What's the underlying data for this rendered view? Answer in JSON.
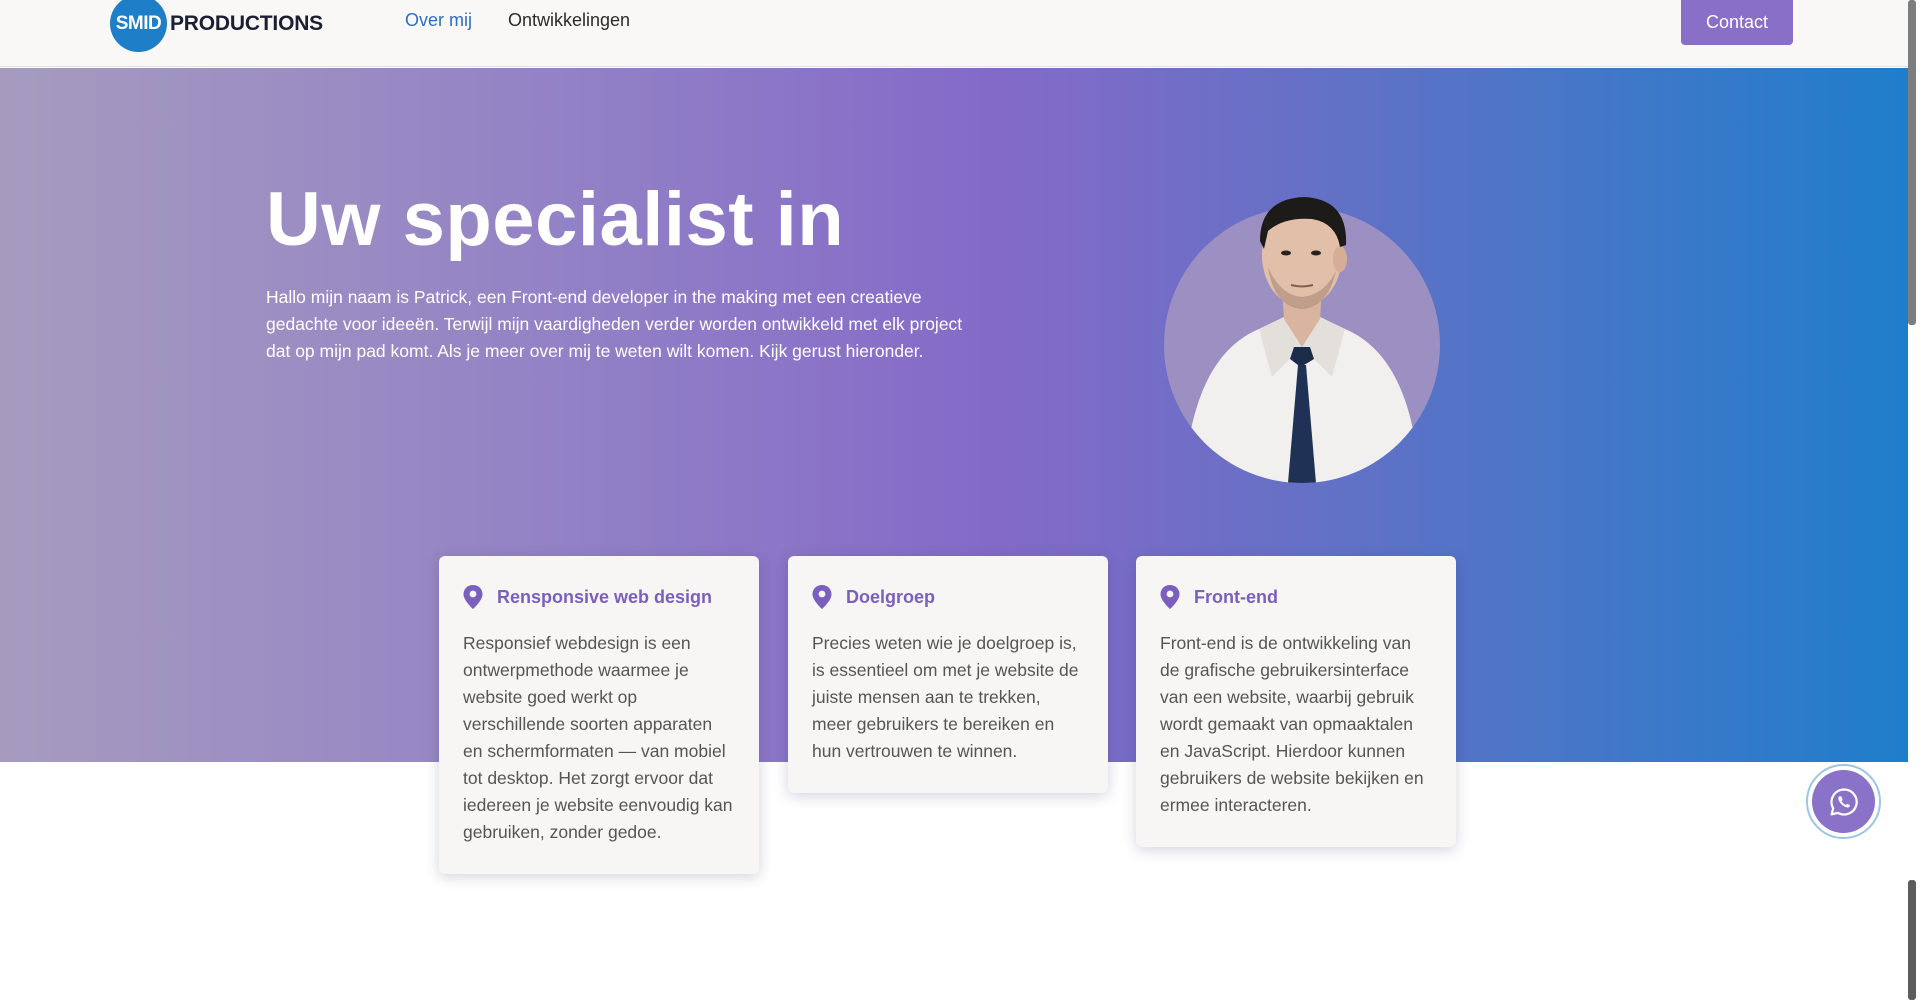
{
  "header": {
    "logo_mark": "SMID",
    "logo_text": "PRODUCTIONS",
    "nav": [
      {
        "label": "Over mij",
        "active": true
      },
      {
        "label": "Ontwikkelingen",
        "active": false
      }
    ],
    "contact_label": "Contact"
  },
  "hero": {
    "title": "Uw specialist in",
    "text": "Hallo mijn naam is Patrick, een Front-end developer in the making met een creatieve gedachte voor ideeën. Terwijl mijn vaardigheden verder worden ontwikkeld met elk project dat op mijn pad komt. Als je meer over mij te weten wilt komen. Kijk gerust hieronder."
  },
  "cards": [
    {
      "icon": "map-pin-icon",
      "title": "Rensponsive web design",
      "body": "Responsief webdesign is een ontwerpmethode waarmee je website goed werkt op verschillende soorten apparaten en schermformaten — van mobiel tot desktop. Het zorgt ervoor dat iedereen je website eenvoudig kan gebruiken, zonder gedoe."
    },
    {
      "icon": "map-pin-icon",
      "title": "Doelgroep",
      "body": "Precies weten wie je doelgroep is, is essentieel om met je website de juiste mensen aan te trekken, meer gebruikers te bereiken en hun vertrouwen te winnen."
    },
    {
      "icon": "map-pin-icon",
      "title": "Front-end",
      "body": "Front-end is de ontwikkeling van de grafische gebruikersinterface van een website, waarbij gebruik wordt gemaakt van opmaaktalen en JavaScript. Hierdoor kunnen gebruikers de website bekijken en ermee interacteren."
    }
  ],
  "floating": {
    "icon": "whatsapp-icon"
  },
  "colors": {
    "accent": "#8a6fc8",
    "brand_blue": "#1e7fc8",
    "card_title": "#7b5fbf",
    "nav_active": "#2c6fc2"
  }
}
